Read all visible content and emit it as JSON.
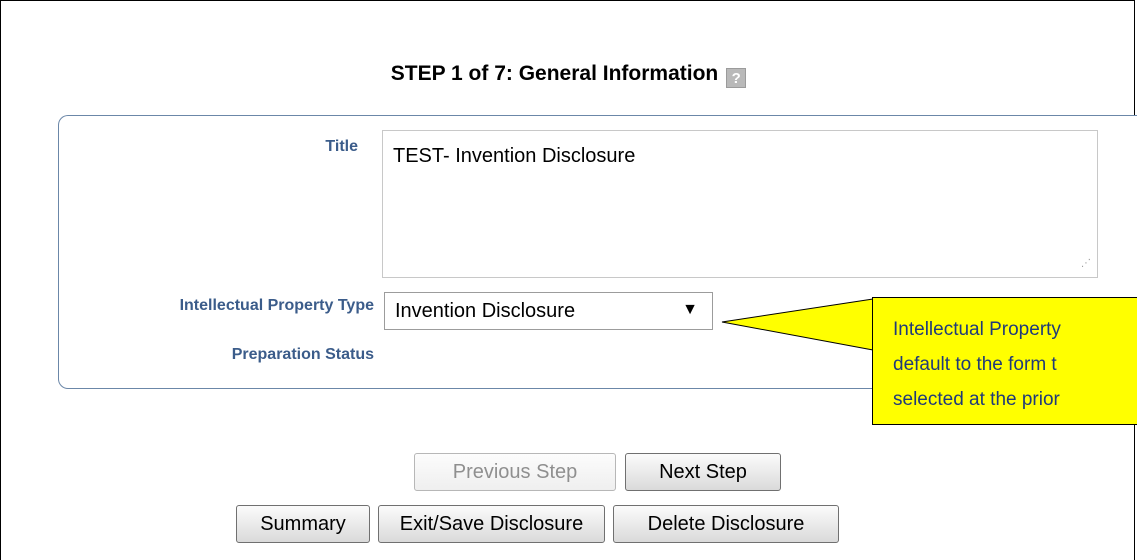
{
  "header": {
    "step_title": "STEP 1 of 7: General Information",
    "help_icon": "help-question-icon"
  },
  "form": {
    "title_label": "Title",
    "title_value": "TEST- Invention Disclosure",
    "ip_type_label": "Intellectual Property Type",
    "ip_type_value": "Invention Disclosure",
    "prep_status_label": "Preparation Status"
  },
  "callout": {
    "lines": [
      "Intellectual Property",
      "default to the form t",
      "selected at the prior"
    ]
  },
  "nav": {
    "previous_label": "Previous Step",
    "next_label": "Next Step"
  },
  "actions": {
    "summary_label": "Summary",
    "exit_save_label": "Exit/Save Disclosure",
    "delete_label": "Delete Disclosure"
  }
}
